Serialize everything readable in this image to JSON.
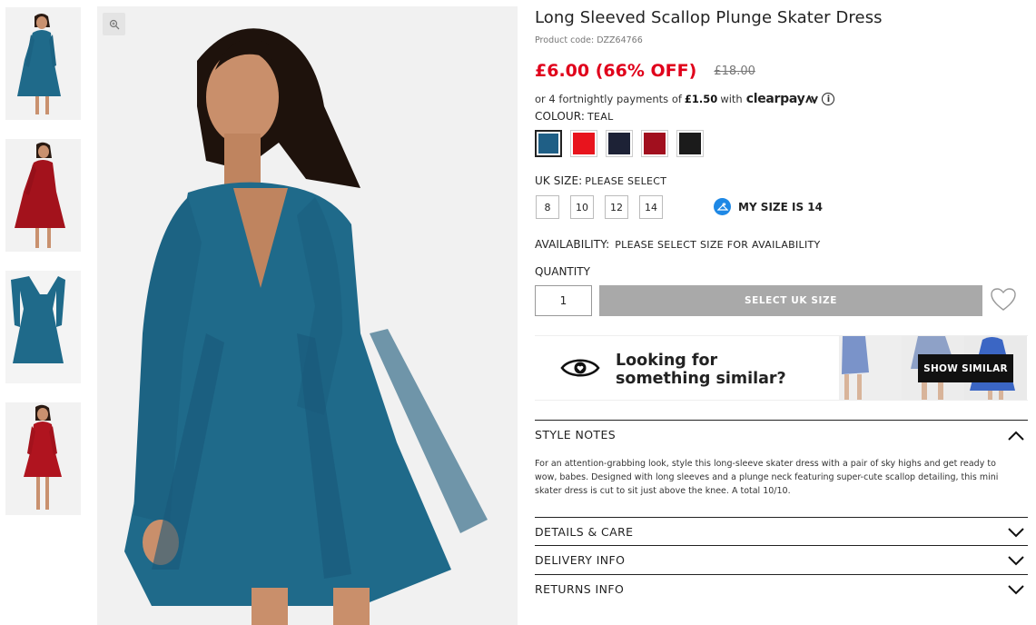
{
  "product": {
    "title": "Long Sleeved Scallop Plunge Skater Dress",
    "code": "Product code: DZZ64766",
    "price_now": "£6.00 (66% OFF)",
    "price_was": "£18.00"
  },
  "clearpay": {
    "prefix": "or 4 fortnightly payments of",
    "amount": "£1.50",
    "suffix": "with",
    "logo": "clearpay",
    "info_icon": "info-icon"
  },
  "colour": {
    "label": "COLOUR:",
    "selected": "TEAL",
    "swatches": [
      {
        "name": "teal",
        "color": "#1f5f86"
      },
      {
        "name": "red",
        "color": "#e8141d"
      },
      {
        "name": "navy",
        "color": "#1d2236"
      },
      {
        "name": "berry",
        "color": "#a10f1e"
      },
      {
        "name": "black",
        "color": "#1b1b1b"
      }
    ]
  },
  "size": {
    "label": "UK SIZE:",
    "selected": "PLEASE SELECT",
    "options": [
      "8",
      "10",
      "12",
      "14"
    ],
    "my_size": "MY SIZE IS 14"
  },
  "availability": {
    "label": "AVAILABILITY:",
    "value": "PLEASE SELECT SIZE FOR AVAILABILITY"
  },
  "quantity": {
    "label": "QUANTITY",
    "value": "1"
  },
  "add_button": "SELECT UK SIZE",
  "similar": {
    "line1": "Looking for",
    "line2": "something similar?",
    "button": "SHOW SIMILAR"
  },
  "accordion": {
    "style_notes": {
      "title": "STYLE NOTES",
      "body": "For an attention-grabbing look, style this long-sleeve skater dress with a pair of sky highs and get ready to wow, babes. Designed with long sleeves and a plunge neck featuring super-cute scallop detailing, this mini skater dress is cut to sit just above the knee. A total 10/10."
    },
    "details": {
      "title": "DETAILS & CARE"
    },
    "delivery": {
      "title": "DELIVERY INFO"
    },
    "returns": {
      "title": "RETURNS INFO"
    }
  },
  "colors": {
    "price_red": "#e0001b",
    "button_grey": "#a9a9a9",
    "dress_teal": "#1f6a8a",
    "dress_red": "#a3121c"
  }
}
